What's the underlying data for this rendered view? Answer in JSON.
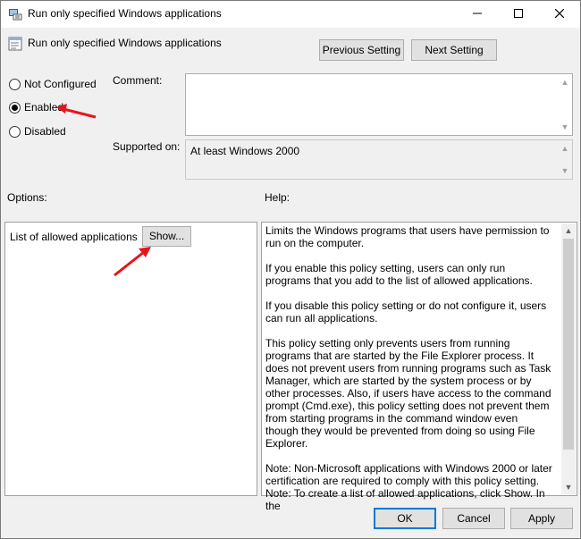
{
  "window": {
    "title": "Run only specified Windows applications",
    "controls": {
      "minimize": "—",
      "maximize": "☐",
      "close": "✕"
    }
  },
  "header": {
    "policy_name": "Run only specified Windows applications",
    "previous_button": "Previous Setting",
    "next_button": "Next Setting"
  },
  "state": {
    "options": [
      "Not Configured",
      "Enabled",
      "Disabled"
    ],
    "selected": "Enabled"
  },
  "comment": {
    "label": "Comment:",
    "value": ""
  },
  "supported": {
    "label": "Supported on:",
    "value": "At least Windows 2000"
  },
  "options_pane": {
    "label": "Options:",
    "list_label": "List of allowed applications",
    "show_button": "Show..."
  },
  "help_pane": {
    "label": "Help:",
    "paragraphs": [
      "Limits the Windows programs that users have permission to run on the computer.",
      "If you enable this policy setting, users can only run programs that you add to the list of allowed applications.",
      "If you disable this policy setting or do not configure it, users can run all applications.",
      "This policy setting only prevents users from running programs that are started by the File Explorer process.  It does not prevent users from running programs such as Task Manager, which are started by the system process or by other processes.  Also, if users have access to the command prompt (Cmd.exe), this policy setting does not prevent them from starting programs in the command window even though they would be prevented from doing so using File Explorer.",
      "Note: Non-Microsoft applications with Windows 2000 or later certification are required to comply with this policy setting.",
      "Note: To create a list of allowed applications, click Show.  In the"
    ]
  },
  "footer": {
    "ok": "OK",
    "cancel": "Cancel",
    "apply": "Apply"
  },
  "colors": {
    "accent": "#0078d7",
    "annotation_arrow": "#e8141b",
    "dialog_bg": "#f0f0f0"
  },
  "icons": {
    "title": "group-policy-icon",
    "header": "policy-setting-icon"
  }
}
